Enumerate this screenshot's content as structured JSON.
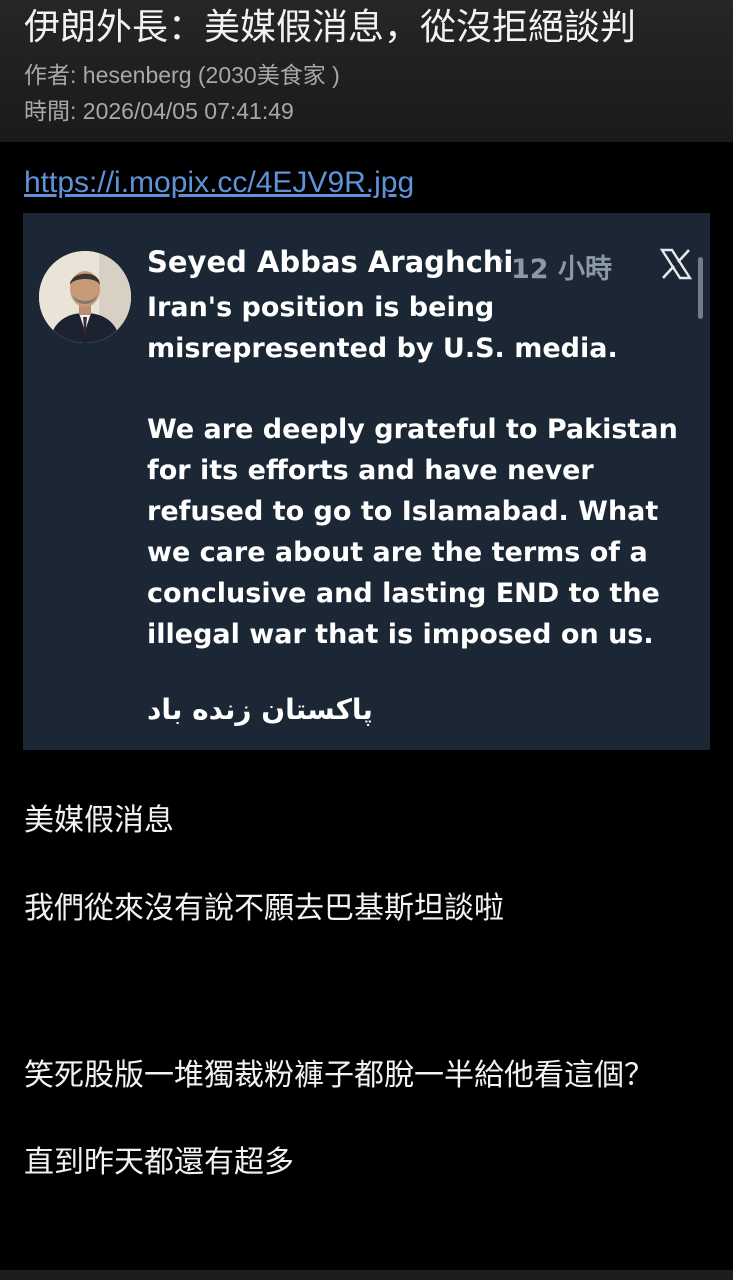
{
  "header": {
    "title": "伊朗外長：美媒假消息，從沒拒絕談判",
    "author": "作者: hesenberg (2030美食家 )",
    "time": "時間: 2026/04/05 07:41:49"
  },
  "post": {
    "link": "https://i.mopix.cc/4EJV9R.jpg",
    "lines": [
      "美媒假消息",
      "我們從來沒有說不願去巴基斯坦談啦",
      "笑死股版一堆獨裁粉褲子都脫一半給他看這個？",
      "直到昨天都還有超多"
    ]
  },
  "tweet": {
    "author": "Seyed Abbas Araghchi",
    "separator": "·",
    "time": "12 小時",
    "close_icon": "x-icon",
    "para1": "Iran's position is being misrepresented by U.S. media.",
    "para2": "We are deeply grateful to Pakistan for its efforts and have never refused to go to Islamabad. What we care about are the terms of a conclusive and lasting END to the illegal war that is imposed on us.",
    "urdu": "پاکستان زنده باد"
  },
  "colors": {
    "background": "#000000",
    "header_bg": "#262626",
    "link": "#5f92d6",
    "tweet_bg": "#1b2734",
    "meta_text": "#a8a8a8",
    "tweet_muted": "#8b98a5"
  }
}
